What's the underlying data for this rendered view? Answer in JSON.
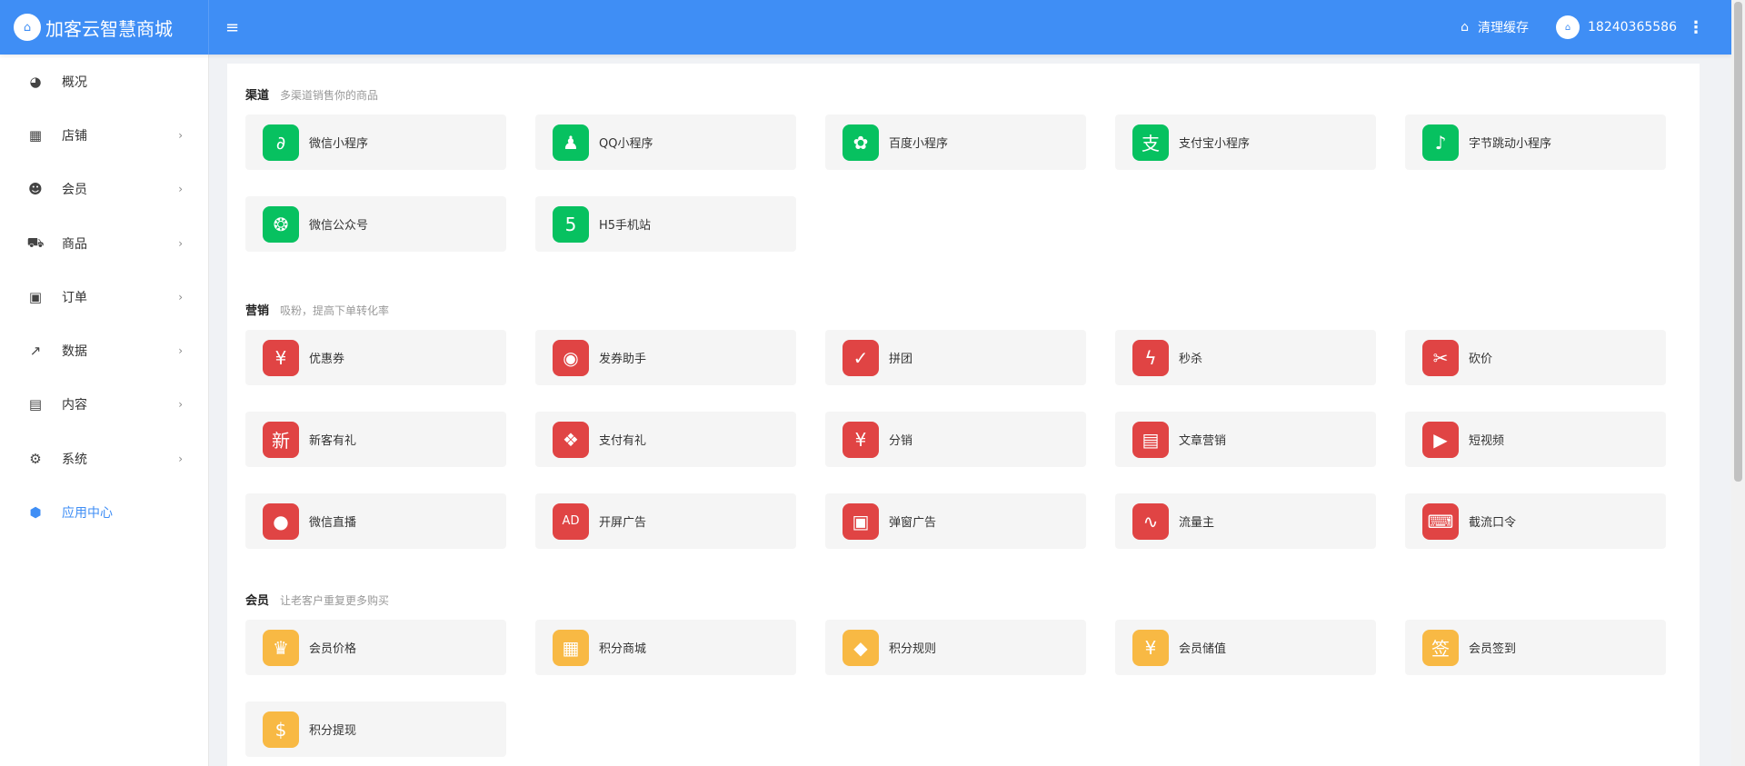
{
  "app": {
    "brand_name": "加客云智慧商城",
    "logo_icon": "store-logo",
    "menu_toggle_icon": "menu-icon",
    "clear_cache_label": "清理缓存",
    "clear_cache_icon": "basket-icon",
    "username": "18240365586",
    "more_icon": "more-vertical-icon",
    "primary_color": "#3f8ef5"
  },
  "sidebar": {
    "items": [
      {
        "id": "overview",
        "label": "概况",
        "icon": "dashboard-icon",
        "has_children": false,
        "active": false
      },
      {
        "id": "store",
        "label": "店铺",
        "icon": "grid-icon",
        "has_children": true,
        "active": false
      },
      {
        "id": "member",
        "label": "会员",
        "icon": "users-icon",
        "has_children": true,
        "active": false
      },
      {
        "id": "goods",
        "label": "商品",
        "icon": "cart-icon",
        "has_children": true,
        "active": false
      },
      {
        "id": "order",
        "label": "订单",
        "icon": "money-icon",
        "has_children": true,
        "active": false
      },
      {
        "id": "data",
        "label": "数据",
        "icon": "line-chart-icon",
        "has_children": true,
        "active": false
      },
      {
        "id": "content",
        "label": "内容",
        "icon": "document-icon",
        "has_children": true,
        "active": false
      },
      {
        "id": "system",
        "label": "系统",
        "icon": "gear-icon",
        "has_children": true,
        "active": false
      },
      {
        "id": "apps",
        "label": "应用中心",
        "icon": "cube-icon",
        "has_children": false,
        "active": true
      }
    ]
  },
  "sections": {
    "channel": {
      "title": "渠道",
      "desc": "多渠道销售你的商品",
      "color": "#07c160",
      "items": [
        {
          "label": "微信小程序",
          "icon": "mini-program-icon",
          "glyph": "∂"
        },
        {
          "label": "QQ小程序",
          "icon": "qq-icon",
          "glyph": "♟"
        },
        {
          "label": "百度小程序",
          "icon": "baidu-icon",
          "glyph": "✿"
        },
        {
          "label": "支付宝小程序",
          "icon": "alipay-icon",
          "glyph": "支"
        },
        {
          "label": "字节跳动小程序",
          "icon": "tiktok-icon",
          "glyph": "♪"
        },
        {
          "label": "微信公众号",
          "icon": "wechat-icon",
          "glyph": "❂"
        },
        {
          "label": "H5手机站",
          "icon": "html5-icon",
          "glyph": "5"
        }
      ]
    },
    "marketing": {
      "title": "营销",
      "desc": "吸粉，提高下单转化率",
      "color": "#e04444",
      "items": [
        {
          "label": "优惠券",
          "icon": "coupon-icon",
          "glyph": "¥"
        },
        {
          "label": "发券助手",
          "icon": "ticket-icon",
          "glyph": "◉"
        },
        {
          "label": "拼团",
          "icon": "group-buy-icon",
          "glyph": "✓"
        },
        {
          "label": "秒杀",
          "icon": "flash-icon",
          "glyph": "ϟ"
        },
        {
          "label": "砍价",
          "icon": "bargain-icon",
          "glyph": "✂"
        },
        {
          "label": "新客有礼",
          "icon": "new-customer-icon",
          "glyph": "新"
        },
        {
          "label": "支付有礼",
          "icon": "gift-icon",
          "glyph": "❖"
        },
        {
          "label": "分销",
          "icon": "money-bag-icon",
          "glyph": "¥"
        },
        {
          "label": "文章营销",
          "icon": "article-icon",
          "glyph": "▤"
        },
        {
          "label": "短视频",
          "icon": "video-icon",
          "glyph": "▶"
        },
        {
          "label": "微信直播",
          "icon": "live-icon",
          "glyph": "●"
        },
        {
          "label": "开屏广告",
          "icon": "ad-icon",
          "glyph": "AD"
        },
        {
          "label": "弹窗广告",
          "icon": "popup-ad-icon",
          "glyph": "▣"
        },
        {
          "label": "流量主",
          "icon": "traffic-icon",
          "glyph": "∿"
        },
        {
          "label": "截流口令",
          "icon": "password-icon",
          "glyph": "⌨"
        }
      ]
    },
    "member": {
      "title": "会员",
      "desc": "让老客户重复更多购买",
      "color": "#f8b944",
      "items": [
        {
          "label": "会员价格",
          "icon": "crown-icon",
          "glyph": "♛"
        },
        {
          "label": "积分商城",
          "icon": "points-store-icon",
          "glyph": "▦"
        },
        {
          "label": "积分规则",
          "icon": "points-rule-icon",
          "glyph": "◆"
        },
        {
          "label": "会员储值",
          "icon": "wallet-icon",
          "glyph": "¥"
        },
        {
          "label": "会员签到",
          "icon": "sign-in-icon",
          "glyph": "签"
        },
        {
          "label": "积分提现",
          "icon": "withdraw-icon",
          "glyph": "$"
        }
      ]
    }
  }
}
